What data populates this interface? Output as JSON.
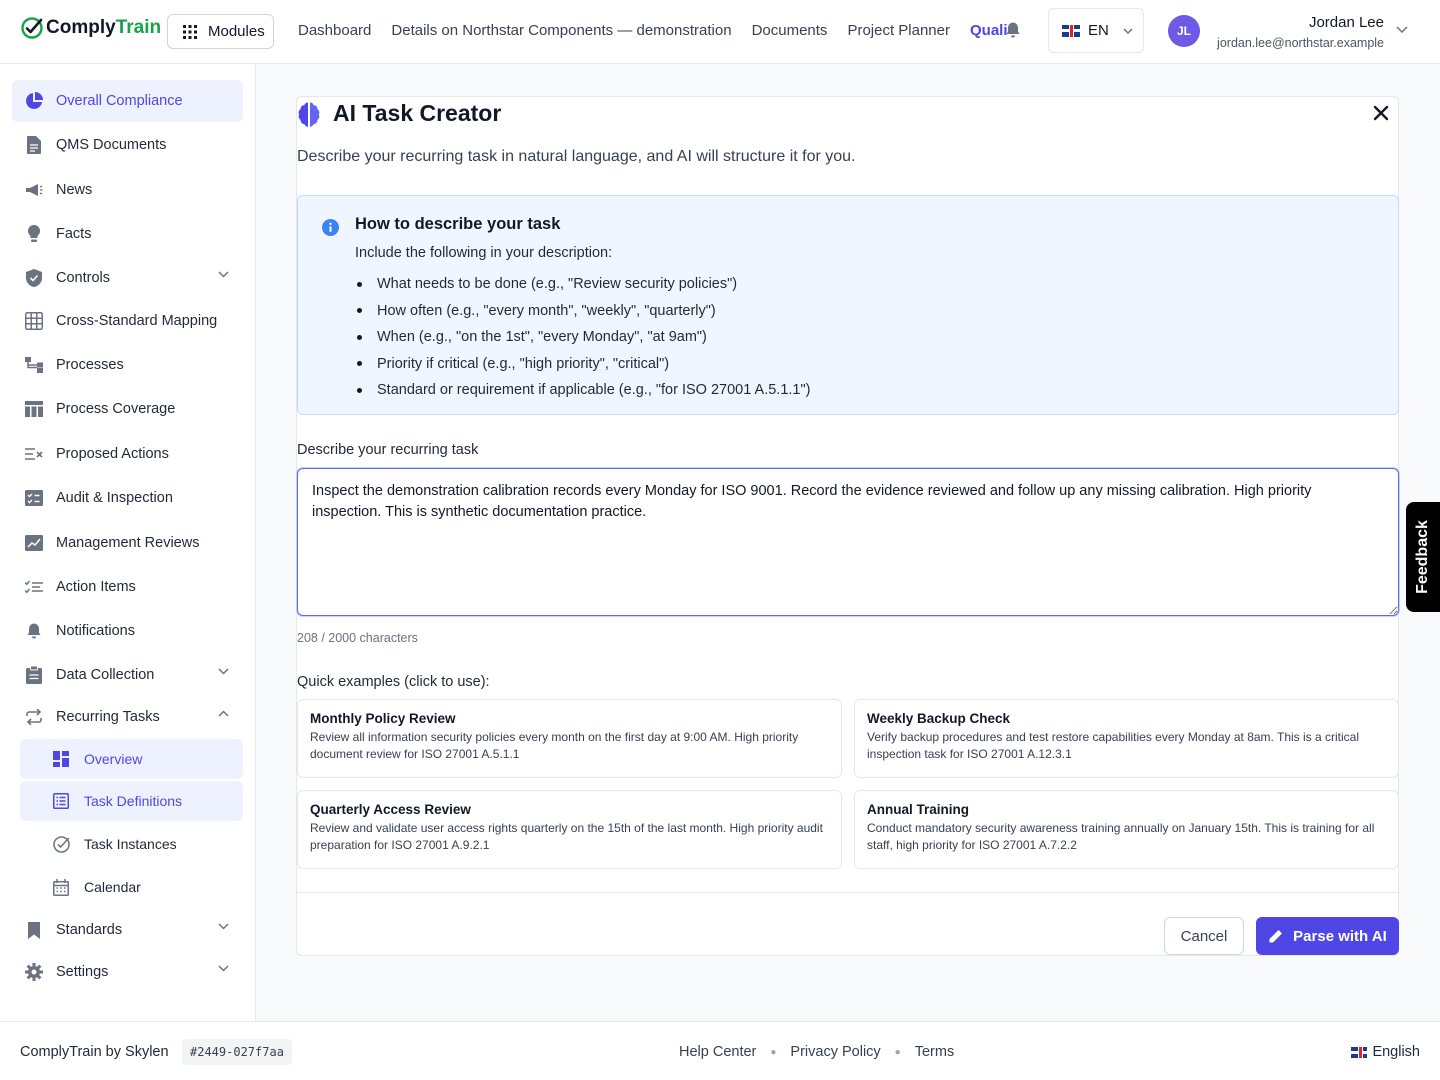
{
  "app": {
    "logo_part1": "Comply",
    "logo_part2": "Train"
  },
  "header": {
    "modules_label": "Modules",
    "nav": [
      "Dashboard",
      "Details on Northstar Components — demonstration",
      "Documents",
      "Project Planner",
      "Quali"
    ],
    "language": "EN",
    "user": {
      "initials": "JL",
      "name": "Jordan Lee",
      "email": "jordan.lee@northstar.example"
    }
  },
  "sidebar": {
    "items": [
      {
        "label": "Overall Compliance",
        "icon": "pie-chart-icon"
      },
      {
        "label": "QMS Documents",
        "icon": "document-icon"
      },
      {
        "label": "News",
        "icon": "megaphone-icon"
      },
      {
        "label": "Facts",
        "icon": "lightbulb-icon"
      },
      {
        "label": "Controls",
        "icon": "shield-icon"
      },
      {
        "label": "Cross-Standard Mapping",
        "icon": "grid-icon"
      },
      {
        "label": "Processes",
        "icon": "flow-icon"
      },
      {
        "label": "Process Coverage",
        "icon": "table-icon"
      },
      {
        "label": "Proposed Actions",
        "icon": "list-x-icon"
      },
      {
        "label": "Audit & Inspection",
        "icon": "checklist-icon"
      },
      {
        "label": "Management Reviews",
        "icon": "chart-edit-icon"
      },
      {
        "label": "Action Items",
        "icon": "checklist-lines-icon"
      },
      {
        "label": "Notifications",
        "icon": "bell-icon"
      },
      {
        "label": "Data Collection",
        "icon": "clipboard-icon"
      },
      {
        "label": "Recurring Tasks",
        "icon": "repeat-icon"
      },
      {
        "label": "Standards",
        "icon": "bookmark-icon"
      },
      {
        "label": "Settings",
        "icon": "gear-icon"
      }
    ],
    "recurring_sub": [
      {
        "label": "Overview",
        "icon": "dashboard-icon"
      },
      {
        "label": "Task Definitions",
        "icon": "list-icon"
      },
      {
        "label": "Task Instances",
        "icon": "check-circle-icon"
      },
      {
        "label": "Calendar",
        "icon": "calendar-icon"
      }
    ]
  },
  "dialog": {
    "title": "AI Task Creator",
    "subtitle": "Describe your recurring task in natural language, and AI will structure it for you.",
    "info_title": "How to describe your task",
    "info_lead": "Include the following in your description:",
    "info_items": [
      "What needs to be done (e.g., \"Review security policies\")",
      "How often (e.g., \"every month\", \"weekly\", \"quarterly\")",
      "When (e.g., \"on the 1st\", \"every Monday\", \"at 9am\")",
      "Priority if critical (e.g., \"high priority\", \"critical\")",
      "Standard or requirement if applicable (e.g., \"for ISO 27001 A.5.1.1\")"
    ],
    "field_label": "Describe your recurring task",
    "task_text": "Inspect the demonstration calibration records every Monday for ISO 9001. Record the evidence reviewed and follow up any missing calibration. High priority inspection. This is synthetic documentation practice.",
    "char_count": "208 / 2000 characters",
    "examples_label": "Quick examples (click to use):",
    "examples": [
      {
        "title": "Monthly Policy Review",
        "desc": "Review all information security policies every month on the first day at 9:00 AM. High priority document review for ISO 27001 A.5.1.1"
      },
      {
        "title": "Weekly Backup Check",
        "desc": "Verify backup procedures and test restore capabilities every Monday at 8am. This is a critical inspection task for ISO 27001 A.12.3.1"
      },
      {
        "title": "Quarterly Access Review",
        "desc": "Review and validate user access rights quarterly on the 15th of the last month. High priority audit preparation for ISO 27001 A.9.2.1"
      },
      {
        "title": "Annual Training",
        "desc": "Conduct mandatory security awareness training annually on January 15th. This is training for all staff, high priority for ISO 27001 A.7.2.2"
      }
    ],
    "cancel_label": "Cancel",
    "parse_label": "Parse with AI"
  },
  "feedback_label": "Feedback",
  "footer": {
    "brand": "ComplyTrain by Skylen",
    "build": "#2449-027f7aa",
    "links": [
      "Help Center",
      "Privacy Policy",
      "Terms"
    ],
    "language": "English"
  },
  "colors": {
    "accent": "#4f46e5",
    "brand_green": "#16a34a",
    "info_bg": "#eff6ff"
  }
}
